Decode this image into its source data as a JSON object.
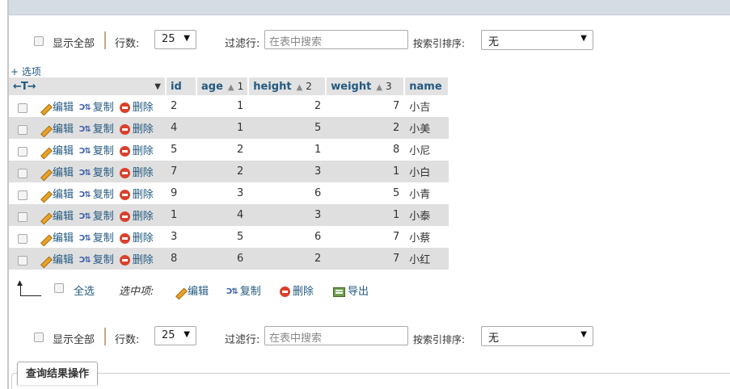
{
  "nav": {
    "show_all": "显示全部",
    "rows_label": "行数:",
    "rows_value": "25",
    "filter_label": "过滤行:",
    "filter_placeholder": "在表中搜索",
    "sort_label": "按索引排序:",
    "sort_value": "无"
  },
  "options_link": "+ 选项",
  "table": {
    "arrows": "←T→",
    "columns": [
      {
        "label": "id",
        "sort_dir": "",
        "sort_order": ""
      },
      {
        "label": "age",
        "sort_dir": "▲",
        "sort_order": "1"
      },
      {
        "label": "height",
        "sort_dir": "▲",
        "sort_order": "2"
      },
      {
        "label": "weight",
        "sort_dir": "▲",
        "sort_order": "3"
      },
      {
        "label": "name",
        "sort_dir": "",
        "sort_order": ""
      }
    ],
    "actions": {
      "edit": "编辑",
      "copy": "复制",
      "delete": "删除"
    },
    "rows": [
      {
        "id": "2",
        "age": "1",
        "height": "2",
        "weight": "7",
        "name": "小吉"
      },
      {
        "id": "4",
        "age": "1",
        "height": "5",
        "weight": "2",
        "name": "小美"
      },
      {
        "id": "5",
        "age": "2",
        "height": "1",
        "weight": "8",
        "name": "小尼"
      },
      {
        "id": "7",
        "age": "2",
        "height": "3",
        "weight": "1",
        "name": "小白"
      },
      {
        "id": "9",
        "age": "3",
        "height": "6",
        "weight": "5",
        "name": "小青"
      },
      {
        "id": "1",
        "age": "4",
        "height": "3",
        "weight": "1",
        "name": "小泰"
      },
      {
        "id": "3",
        "age": "5",
        "height": "6",
        "weight": "7",
        "name": "小蔡"
      },
      {
        "id": "8",
        "age": "6",
        "height": "2",
        "weight": "7",
        "name": "小红"
      }
    ]
  },
  "bulk": {
    "select_all": "全选",
    "with_selected": "选中项:",
    "edit": "编辑",
    "copy": "复制",
    "delete": "删除",
    "export": "导出"
  },
  "footer_tab": "查询结果操作",
  "colors": {
    "link": "#235a81",
    "row_alt": "#dfdfdf",
    "header_bg": "#e2e2e2",
    "top_banner": "#d6dce4"
  }
}
